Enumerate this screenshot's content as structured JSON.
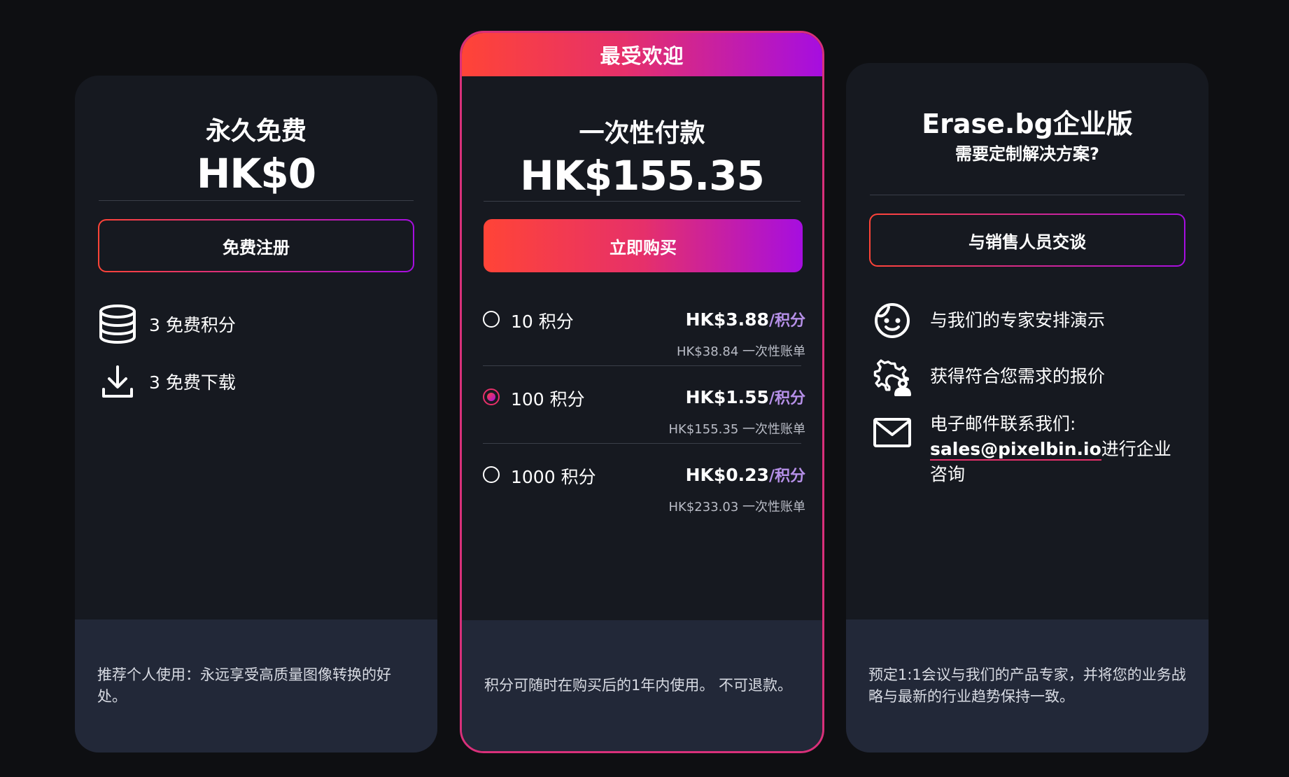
{
  "colors": {
    "background": "#0e0f12",
    "card": "#161920",
    "footer": "#222838",
    "gradient_start": "#ff4437",
    "gradient_end": "#a60ee0",
    "highlight_border": "#d8307a",
    "unit_text": "#b690e8"
  },
  "free_plan": {
    "name": "永久免费",
    "price": "HK$0",
    "button_label": "免费注册",
    "features": [
      {
        "icon": "database-icon",
        "text": "3 免费积分"
      },
      {
        "icon": "download-icon",
        "text": "3 免费下载"
      }
    ],
    "footer": "推荐个人使用：永远享受高质量图像转换的好处。"
  },
  "onetime_plan": {
    "badge": "最受欢迎",
    "name": "一次性付款",
    "price": "HK$155.35",
    "button_label": "立即购买",
    "options": [
      {
        "label": "10 积分",
        "rate": "HK$3.88",
        "unit": "/积分",
        "total": "HK$38.84 一次性账单",
        "selected": false
      },
      {
        "label": "100 积分",
        "rate": "HK$1.55",
        "unit": "/积分",
        "total": "HK$155.35 一次性账单",
        "selected": true
      },
      {
        "label": "1000 积分",
        "rate": "HK$0.23",
        "unit": "/积分",
        "total": "HK$233.03 一次性账单",
        "selected": false
      }
    ],
    "footer": "积分可随时在购买后的1年内使用。 不可退款。"
  },
  "enterprise_plan": {
    "name": "Erase.bg企业版",
    "subtitle": "需要定制解决方案?",
    "button_label": "与销售人员交谈",
    "features": [
      {
        "icon": "smiley-icon",
        "text": "与我们的专家安排演示"
      },
      {
        "icon": "gear-user-icon",
        "text": "获得符合您需求的报价"
      }
    ],
    "email_prefix": "电子邮件联系我们:",
    "email": "sales@pixelbin.io",
    "email_suffix": "进行企业咨询",
    "footer": "预定1:1会议与我们的产品专家，并将您的业务战略与最新的行业趋势保持一致。"
  }
}
